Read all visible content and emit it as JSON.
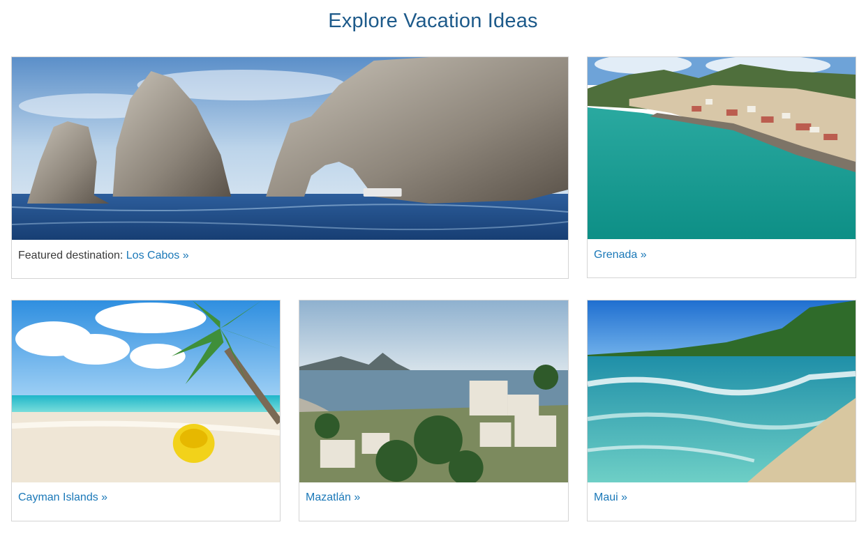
{
  "page": {
    "title": "Explore Vacation Ideas"
  },
  "cards": {
    "featured": {
      "prefix": "Featured destination: ",
      "link": "Los Cabos »",
      "image": "los-cabos-arch-rocks-photo"
    },
    "grenada": {
      "link": "Grenada »",
      "image": "grenada-harbor-photo"
    },
    "cayman": {
      "link": "Cayman Islands »",
      "image": "cayman-beach-palm-kayak-photo"
    },
    "mazatlan": {
      "link": "Mazatlán »",
      "image": "mazatlan-coastline-photo"
    },
    "maui": {
      "link": "Maui »",
      "image": "maui-surf-beach-photo"
    }
  },
  "colors": {
    "title": "#1d5a8a",
    "link": "#1a78b8",
    "text": "#3a3a3a",
    "border": "#d4d4d4"
  }
}
